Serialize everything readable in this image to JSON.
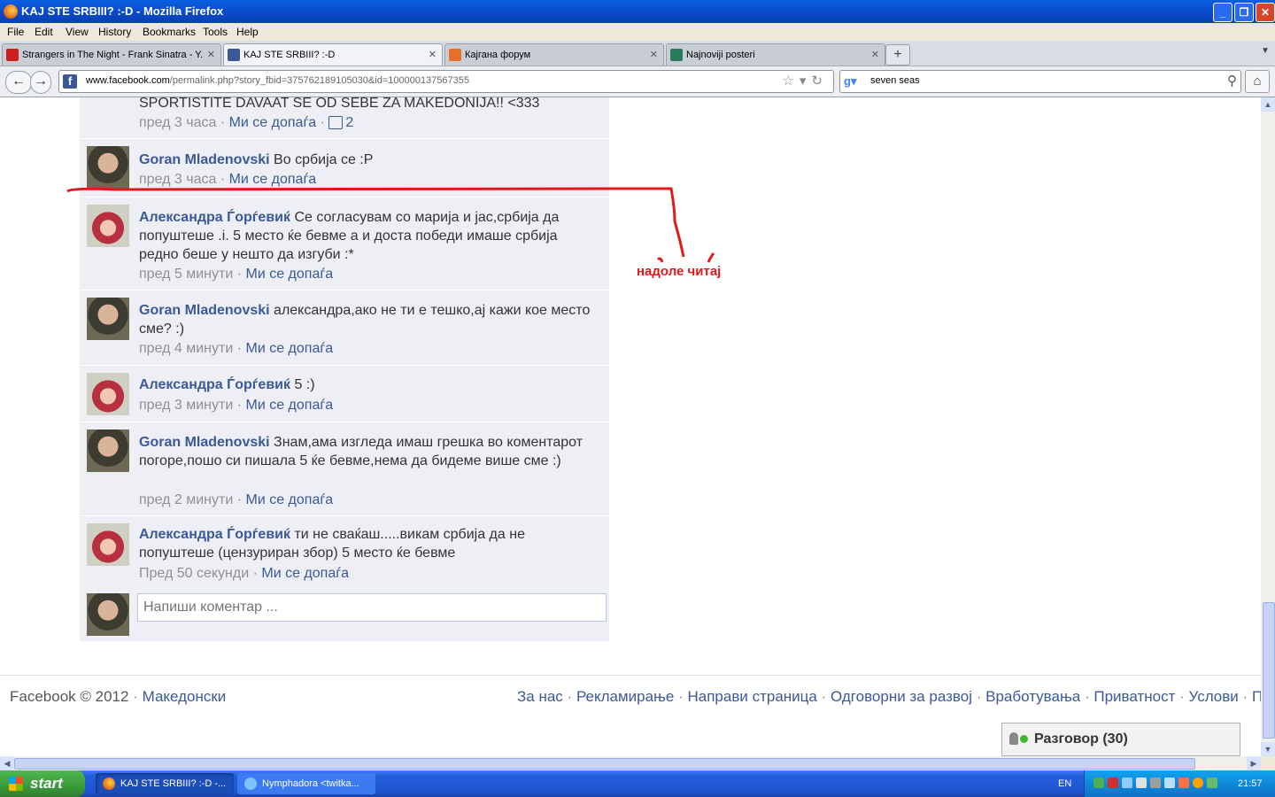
{
  "window": {
    "title": "KAJ STE SRBIII? :-D - Mozilla Firefox"
  },
  "menu": [
    "File",
    "Edit",
    "View",
    "History",
    "Bookmarks",
    "Tools",
    "Help"
  ],
  "tabs": [
    {
      "label": "Strangers in The Night - Frank Sinatra - Y...",
      "icon": "youtube-icon",
      "color": "#cc1f1f"
    },
    {
      "label": "KAJ STE SRBIII? :-D",
      "icon": "facebook-icon",
      "color": "#3b5998"
    },
    {
      "label": "Кајгана форум",
      "icon": "kajgana-icon",
      "color": "#e8702a"
    },
    {
      "label": "Najnoviji posteri",
      "icon": "v-icon",
      "color": "#2a7a5c"
    }
  ],
  "nav": {
    "url_host": "www.facebook.com",
    "url_rest": "/permalink.php?story_fbid=375762189105030&id=100000137567355",
    "search": "seven seas"
  },
  "comments": [
    {
      "author": "",
      "text": "SPORTISTITE DAVAAT SE OD SEBE ZA MAKEDONIJA!! <333",
      "time": "пред 3 часа",
      "like": "Ми се допаѓа",
      "likes": "2",
      "avatar": "none"
    },
    {
      "author": "Goran Mladenovski",
      "text": "Во србија се :P",
      "time": "пред 3 часа",
      "like": "Ми се допаѓа",
      "avatar": "goran"
    },
    {
      "author": "Александра Ѓорѓевиќ",
      "text": "Се согласувам со марија и јас,србија да попуштеше .i. 5 место ќе бевме а и доста победи имаше србија редно беше у нешто да изгуби :*",
      "time": "пред 5 минути",
      "like": "Ми се допаѓа",
      "avatar": "aleks"
    },
    {
      "author": "Goran Mladenovski",
      "text": "александра,ако не ти е тешко,ај кажи кое место сме? :)",
      "time": "пред 4 минути",
      "like": "Ми се допаѓа",
      "avatar": "goran"
    },
    {
      "author": "Александра Ѓорѓевиќ",
      "text": "5 :)",
      "time": "пред 3 минути",
      "like": "Ми се допаѓа",
      "avatar": "aleks"
    },
    {
      "author": "Goran Mladenovski",
      "text": "Знам,ама изгледа имаш грешка во коментарот погоре,пошо си пишала 5 ќе бевме,нема да бидеме више сме :)",
      "time": "пред 2 минути",
      "like": "Ми се допаѓа",
      "avatar": "goran"
    },
    {
      "author": "Александра Ѓорѓевиќ",
      "text": "ти не сваќаш.....викам србија да не попуштеше (цензуриран збор) 5 место ќе бевме",
      "time": "Пред 50 секунди",
      "like": "Ми се допаѓа",
      "avatar": "aleks"
    }
  ],
  "new_comment_placeholder": "Напиши коментар ...",
  "annotation": "надоле читај",
  "footer": {
    "copyright": "Facebook © 2012",
    "language": "Македонски",
    "links": [
      "За нас",
      "Рекламирање",
      "Направи страница",
      "Одговорни за развој",
      "Вработувања",
      "Приватност",
      "Услови",
      "По"
    ]
  },
  "chat": {
    "label": "Разговор (30)"
  },
  "taskbar": {
    "start": "start",
    "items": [
      "KAJ STE SRBIII? :-D -...",
      "Nymphadora <twitka..."
    ],
    "lang": "EN",
    "clock": "21:57"
  },
  "colors": {
    "facebook_blue": "#3b5998",
    "comment_bg": "#edeff4",
    "annotation_red": "#e01a1a"
  }
}
